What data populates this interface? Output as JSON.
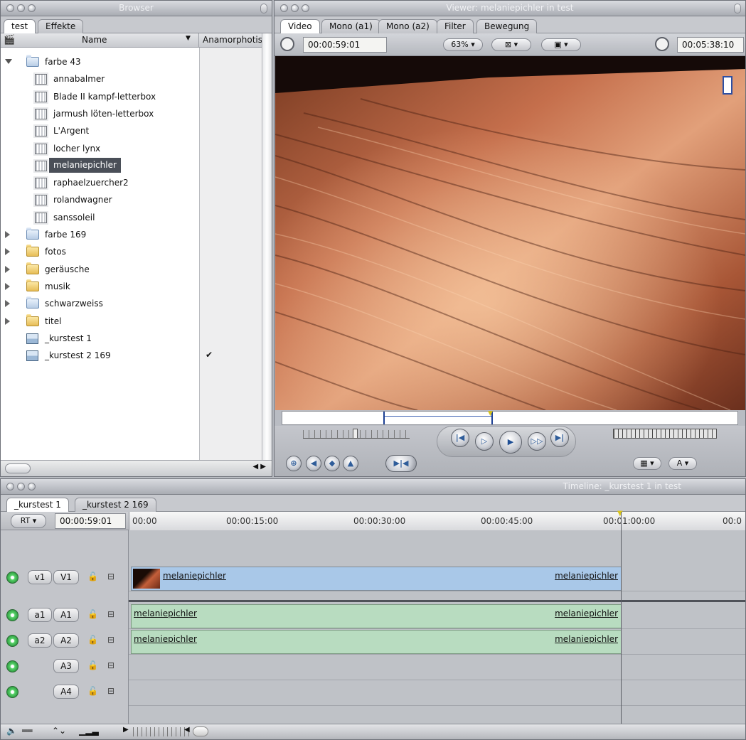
{
  "browser": {
    "title": "Browser",
    "tabs": [
      "test",
      "Effekte"
    ],
    "columns": {
      "name": "Name",
      "anamorphic": "Anamorphotis"
    },
    "items": [
      {
        "type": "folder-open",
        "label": "farbe 43",
        "indent": 0
      },
      {
        "type": "clip",
        "label": "annabalmer",
        "indent": 1
      },
      {
        "type": "clip",
        "label": "Blade II kampf-letterbox",
        "indent": 1
      },
      {
        "type": "clip",
        "label": "jarmush löten-letterbox",
        "indent": 1
      },
      {
        "type": "clip",
        "label": "L'Argent",
        "indent": 1
      },
      {
        "type": "clip",
        "label": "locher lynx",
        "indent": 1
      },
      {
        "type": "clip",
        "label": "melaniepichler",
        "indent": 1,
        "selected": true
      },
      {
        "type": "clip",
        "label": "raphaelzuercher2",
        "indent": 1
      },
      {
        "type": "clip",
        "label": "rolandwagner",
        "indent": 1
      },
      {
        "type": "clip",
        "label": "sanssoleil",
        "indent": 1
      },
      {
        "type": "folder",
        "label": "farbe 169",
        "indent": 0
      },
      {
        "type": "folder-y",
        "label": "fotos",
        "indent": 0
      },
      {
        "type": "folder-y",
        "label": "geräusche",
        "indent": 0
      },
      {
        "type": "folder-y",
        "label": "musik",
        "indent": 0
      },
      {
        "type": "folder",
        "label": "schwarzweiss",
        "indent": 0
      },
      {
        "type": "folder-y",
        "label": "titel",
        "indent": 0
      },
      {
        "type": "sequence",
        "label": "_kurstest 1",
        "indent": 0
      },
      {
        "type": "sequence",
        "label": "_kurstest 2 169",
        "indent": 0,
        "anamorphic": "✔"
      }
    ]
  },
  "viewer": {
    "title": "Viewer: melaniepichler in test",
    "tabs": [
      "Video",
      "Mono (a1)",
      "Mono (a2)",
      "Filter",
      "Bewegung"
    ],
    "timecode_left": "00:00:59:01",
    "zoom": "63%",
    "timecode_right": "00:05:38:10"
  },
  "timeline": {
    "title": "Timeline: _kurstest 1 in test",
    "tabs": [
      "_kurstest 1",
      "_kurstest 2 169"
    ],
    "rt": "RT",
    "timecode": "00:00:59:01",
    "ruler": [
      "00:00",
      "00:00:15:00",
      "00:00:30:00",
      "00:00:45:00",
      "00:01:00:00",
      "00:0"
    ],
    "tracks": [
      {
        "src": "v1",
        "dst": "V1",
        "kind": "video",
        "clip": "melaniepichler"
      },
      {
        "src": "a1",
        "dst": "A1",
        "kind": "audio",
        "clip": "melaniepichler"
      },
      {
        "src": "a2",
        "dst": "A2",
        "kind": "audio",
        "clip": "melaniepichler"
      },
      {
        "src": "",
        "dst": "A3",
        "kind": "audio",
        "clip": ""
      },
      {
        "src": "",
        "dst": "A4",
        "kind": "audio",
        "clip": ""
      }
    ]
  }
}
